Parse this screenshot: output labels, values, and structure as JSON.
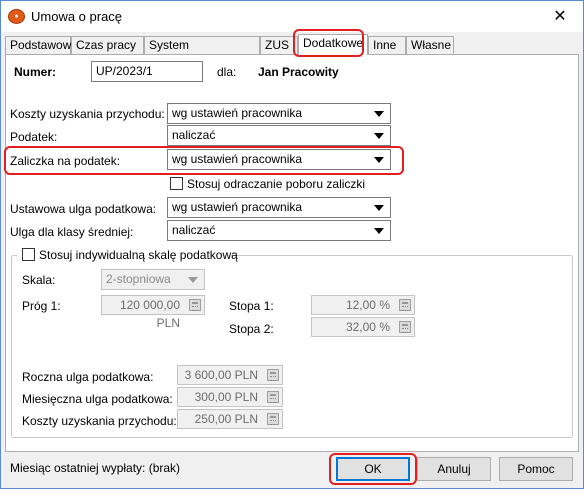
{
  "window": {
    "title": "Umowa o pracę",
    "icon_name": "app-logo-icon",
    "close_symbol": "✕",
    "accent_color": "#e02020"
  },
  "tabs": [
    {
      "label": "Podstawowe",
      "active": false
    },
    {
      "label": "Czas pracy",
      "active": false
    },
    {
      "label": "System wynagrodzeń",
      "active": false
    },
    {
      "label": "ZUS",
      "active": false
    },
    {
      "label": "Dodatkowe",
      "active": true
    },
    {
      "label": "Inne",
      "active": false
    },
    {
      "label": "Własne",
      "active": false
    }
  ],
  "header": {
    "numer_label": "Numer:",
    "numer_value": "UP/2023/1",
    "dla_label": "dla:",
    "employee_name": "Jan Pracowity"
  },
  "fields": {
    "koszty_label": "Koszty uzyskania przychodu:",
    "koszty_value": "wg ustawień pracownika",
    "podatek_label": "Podatek:",
    "podatek_value": "naliczać",
    "zaliczka_label": "Zaliczka na podatek:",
    "zaliczka_value": "wg ustawień pracownika",
    "odraczanie_label": "Stosuj odraczanie poboru zaliczki",
    "odraczanie_checked": false,
    "ulga_label": "Ustawowa ulga podatkowa:",
    "ulga_value": "wg ustawień pracownika",
    "ulga_srednia_label": "Ulga dla klasy średniej:",
    "ulga_srednia_value": "naliczać"
  },
  "scale_group": {
    "title": "Stosuj indywidualną skalę podatkową",
    "checked": false,
    "skala_label": "Skala:",
    "skala_value": "2-stopniowa",
    "prog1_label": "Próg 1:",
    "prog1_value": "120 000,00 PLN",
    "stopa1_label": "Stopa 1:",
    "stopa1_value": "12,00 %",
    "stopa2_label": "Stopa 2:",
    "stopa2_value": "32,00 %",
    "roczna_label": "Roczna ulga podatkowa:",
    "roczna_value": "3 600,00 PLN",
    "miesieczna_label": "Miesięczna ulga podatkowa:",
    "miesieczna_value": "300,00 PLN",
    "koszty_label": "Koszty uzyskania przychodu:",
    "koszty_value": "250,00 PLN"
  },
  "footer": {
    "status_text": "Miesiąc ostatniej wypłaty: (brak)",
    "ok_label": "OK",
    "cancel_label": "Anuluj",
    "help_label": "Pomoc"
  }
}
